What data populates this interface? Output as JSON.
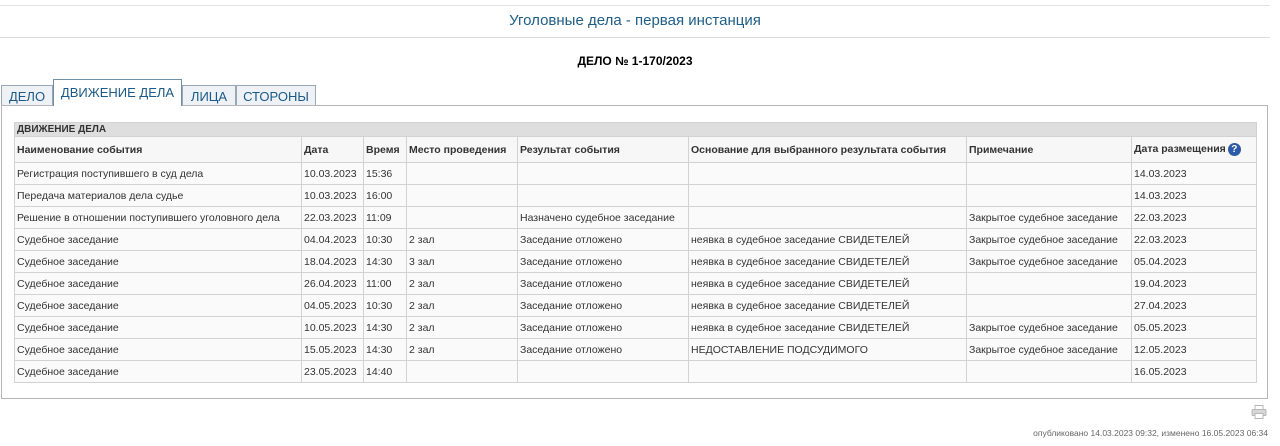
{
  "header": {
    "title": "Уголовные дела - первая инстанция",
    "case_number": "ДЕЛО № 1-170/2023"
  },
  "tabs": [
    {
      "label": "ДЕЛО",
      "active": false
    },
    {
      "label": "ДВИЖЕНИЕ ДЕЛА",
      "active": true
    },
    {
      "label": "ЛИЦА",
      "active": false
    },
    {
      "label": "СТОРОНЫ",
      "active": false
    }
  ],
  "table": {
    "section_title": "ДВИЖЕНИЕ ДЕЛА",
    "columns": [
      "Наименование события",
      "Дата",
      "Время",
      "Место проведения",
      "Результат события",
      "Основание для выбранного результата события",
      "Примечание",
      "Дата размещения"
    ],
    "help_icon": "?",
    "rows": [
      [
        "Регистрация поступившего в суд дела",
        "10.03.2023",
        "15:36",
        "",
        "",
        "",
        "",
        "14.03.2023"
      ],
      [
        "Передача материалов дела судье",
        "10.03.2023",
        "16:00",
        "",
        "",
        "",
        "",
        "14.03.2023"
      ],
      [
        "Решение в отношении поступившего уголовного дела",
        "22.03.2023",
        "11:09",
        "",
        "Назначено судебное заседание",
        "",
        "Закрытое судебное заседание",
        "22.03.2023"
      ],
      [
        "Судебное заседание",
        "04.04.2023",
        "10:30",
        "2 зал",
        "Заседание отложено",
        "неявка в судебное заседание СВИДЕТЕЛЕЙ",
        "Закрытое судебное заседание",
        "22.03.2023"
      ],
      [
        "Судебное заседание",
        "18.04.2023",
        "14:30",
        "3 зал",
        "Заседание отложено",
        "неявка в судебное заседание СВИДЕТЕЛЕЙ",
        "Закрытое судебное заседание",
        "05.04.2023"
      ],
      [
        "Судебное заседание",
        "26.04.2023",
        "11:00",
        "2 зал",
        "Заседание отложено",
        "неявка в судебное заседание СВИДЕТЕЛЕЙ",
        "",
        "19.04.2023"
      ],
      [
        "Судебное заседание",
        "04.05.2023",
        "10:30",
        "2 зал",
        "Заседание отложено",
        "неявка в судебное заседание СВИДЕТЕЛЕЙ",
        "",
        "27.04.2023"
      ],
      [
        "Судебное заседание",
        "10.05.2023",
        "14:30",
        "2 зал",
        "Заседание отложено",
        "неявка в судебное заседание СВИДЕТЕЛЕЙ",
        "Закрытое судебное заседание",
        "05.05.2023"
      ],
      [
        "Судебное заседание",
        "15.05.2023",
        "14:30",
        "2 зал",
        "Заседание отложено",
        "НЕДОСТАВЛЕНИЕ ПОДСУДИМОГО",
        "Закрытое судебное заседание",
        "12.05.2023"
      ],
      [
        "Судебное заседание",
        "23.05.2023",
        "14:40",
        "",
        "",
        "",
        "",
        "16.05.2023"
      ]
    ]
  },
  "footer": {
    "meta": "опубликовано 14.03.2023 09:32, изменено 16.05.2023 06:34",
    "print_icon": "printer-icon"
  },
  "colors": {
    "title": "#1d5e8c",
    "tab_text": "#1a5a8a",
    "section_bg": "#dedede",
    "help_icon_bg": "#2e59a8"
  }
}
